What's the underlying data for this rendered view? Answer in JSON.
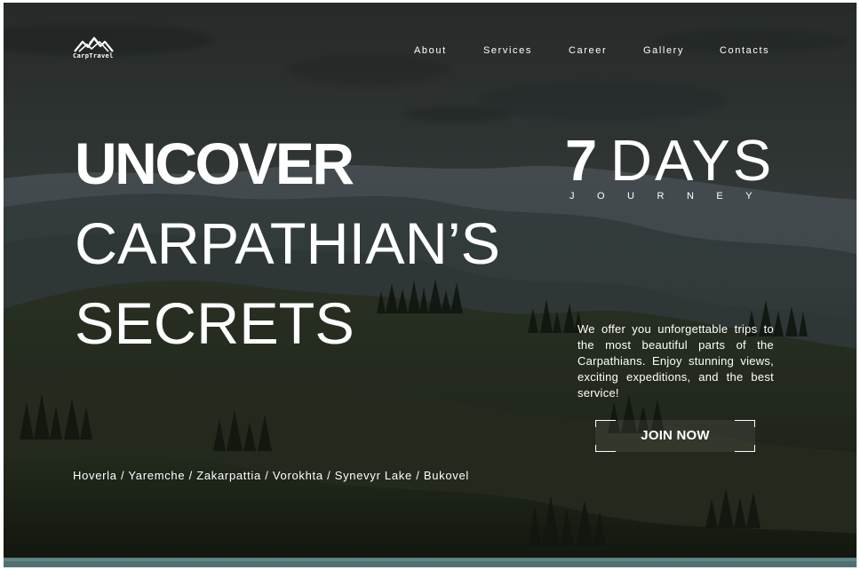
{
  "brand": {
    "name": "CarpTravel",
    "logo_icon": "mountain-logo-icon"
  },
  "navigation": {
    "items": [
      {
        "label": "About"
      },
      {
        "label": "Services"
      },
      {
        "label": "Career"
      },
      {
        "label": "Gallery"
      },
      {
        "label": "Contacts"
      }
    ]
  },
  "hero": {
    "headline": {
      "line_1": "UNCOVER",
      "line_2": "CARPATHIAN’S",
      "line_3": "SECRETS"
    },
    "tour": {
      "number": "7",
      "word": "DAYS",
      "caption": "JOURNEY"
    },
    "description": "We offer you unforgettable trips to the most beautiful parts of the Carpathians. Enjoy stunning views, exciting expeditions, and the best service!",
    "button_label": "JOIN NOW",
    "locations": "Hoverla / Yaremche / Zakarpattia / Vorokhta / Synevyr Lake / Bukovel"
  },
  "colors": {
    "text": "#ffffff",
    "background_tint": "#2c3330"
  }
}
